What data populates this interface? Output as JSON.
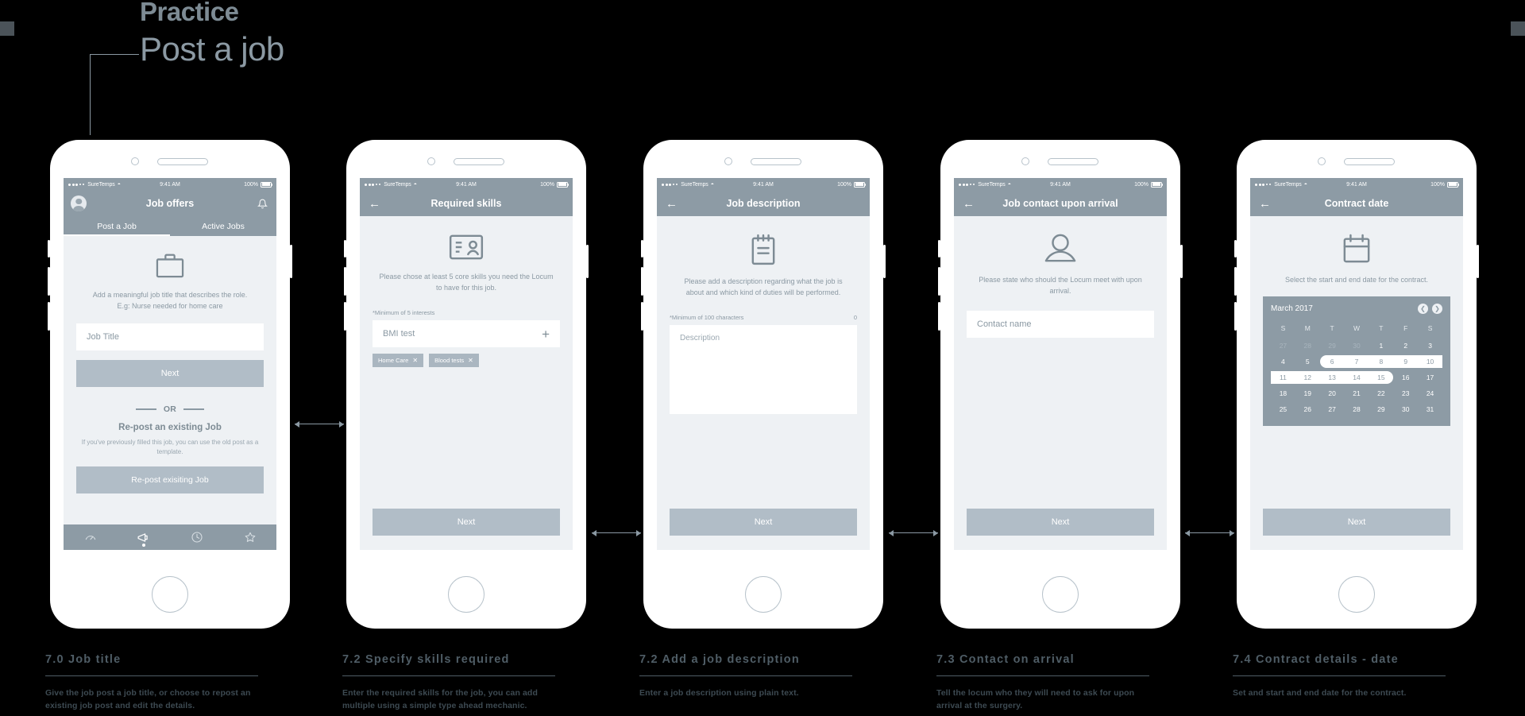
{
  "header": {
    "eyebrow": "Practice",
    "title": "Post a job"
  },
  "status_bar": {
    "carrier": "SureTemps",
    "time": "9:41 AM",
    "battery": "100%"
  },
  "screens": [
    {
      "id": "job-title",
      "nav_title": "Job offers",
      "left_icon": "avatar-icon",
      "right_icon": "bell-icon",
      "tabs": [
        {
          "label": "Post a Job",
          "active": true
        },
        {
          "label": "Active Jobs",
          "active": false
        }
      ],
      "hero_icon": "briefcase-icon",
      "helper": "Add a meaningful job title that describes the role.\nE.g: Nurse needed for home care",
      "field_placeholder": "Job Title",
      "next_label": "Next",
      "or_label": "OR",
      "repost_heading": "Re-post an existing Job",
      "repost_copy": "If you've previously filled this job, you can use the old post as a template.",
      "repost_button": "Re-post exisiting Job",
      "tabbar": [
        {
          "icon": "gauge-icon",
          "active": false
        },
        {
          "icon": "megaphone-icon",
          "active": true
        },
        {
          "icon": "clock-icon",
          "active": false
        },
        {
          "icon": "star-icon",
          "active": false
        }
      ]
    },
    {
      "id": "required-skills",
      "nav_title": "Required skills",
      "left_icon": "back-arrow-icon",
      "hero_icon": "id-card-icon",
      "helper": "Please chose at least 5 core skills you need the Locum to have for this job.",
      "minimum_label": "*Minimum of 5 interests",
      "field_value": "BMI test",
      "add_icon": "plus-icon",
      "chips": [
        "Home Care",
        "Blood tests"
      ],
      "next_label": "Next"
    },
    {
      "id": "job-description",
      "nav_title": "Job description",
      "left_icon": "back-arrow-icon",
      "hero_icon": "notepad-icon",
      "helper": "Please add a description regarding what the job is about and which kind of duties will be performed.",
      "minimum_label": "*Minimum of 100 characters",
      "counter": "0",
      "textarea_placeholder": "Description",
      "next_label": "Next"
    },
    {
      "id": "job-contact",
      "nav_title": "Job contact upon arrival",
      "left_icon": "back-arrow-icon",
      "hero_icon": "person-icon",
      "helper": "Please state who should the Locum meet with upon arrival.",
      "field_placeholder": "Contact name",
      "next_label": "Next"
    },
    {
      "id": "contract-date",
      "nav_title": "Contract date",
      "left_icon": "back-arrow-icon",
      "hero_icon": "calendar-icon",
      "helper": "Select the start and end date for the contract.",
      "next_label": "Next",
      "calendar": {
        "month": "March 2017",
        "prev_icon": "chevron-left-icon",
        "next_icon": "chevron-right-icon",
        "day_headers": [
          "S",
          "M",
          "T",
          "W",
          "T",
          "F",
          "S"
        ],
        "weeks": [
          [
            {
              "d": "27",
              "muted": true
            },
            {
              "d": "28",
              "muted": true
            },
            {
              "d": "29",
              "muted": true
            },
            {
              "d": "30",
              "muted": true
            },
            {
              "d": "1"
            },
            {
              "d": "2"
            },
            {
              "d": "3"
            }
          ],
          [
            {
              "d": "4"
            },
            {
              "d": "5"
            },
            {
              "d": "6",
              "sel": true
            },
            {
              "d": "7",
              "sel": true
            },
            {
              "d": "8",
              "sel": true
            },
            {
              "d": "9",
              "sel": true
            },
            {
              "d": "10",
              "sel": true
            }
          ],
          [
            {
              "d": "11",
              "sel": true
            },
            {
              "d": "12",
              "sel": true
            },
            {
              "d": "13",
              "sel": true
            },
            {
              "d": "14",
              "sel": true
            },
            {
              "d": "15",
              "sel": true
            },
            {
              "d": "16"
            },
            {
              "d": "17"
            }
          ],
          [
            {
              "d": "18"
            },
            {
              "d": "19"
            },
            {
              "d": "20"
            },
            {
              "d": "21"
            },
            {
              "d": "22"
            },
            {
              "d": "23"
            },
            {
              "d": "24"
            }
          ],
          [
            {
              "d": "25"
            },
            {
              "d": "26"
            },
            {
              "d": "27"
            },
            {
              "d": "28"
            },
            {
              "d": "29"
            },
            {
              "d": "30"
            },
            {
              "d": "31"
            }
          ]
        ],
        "range_start": "6",
        "range_end": "15"
      }
    }
  ],
  "captions": [
    {
      "title": "7.0 Job title",
      "body": "Give the job post a job title, or choose to repost an existing job post and edit the details."
    },
    {
      "title": "7.2 Specify skills required",
      "body": "Enter the required skills for the job, you can add multiple using a simple type ahead mechanic."
    },
    {
      "title": "7.2 Add a job description",
      "body": "Enter a job description using plain text."
    },
    {
      "title": "7.3 Contact on arrival",
      "body": "Tell the locum who they will need to ask for upon arrival at the surgery."
    },
    {
      "title": "7.4 Contract details - date",
      "body": "Set and start and end date for the contract."
    }
  ],
  "colors": {
    "background": "#000000",
    "chrome": "#8d9ba5",
    "screen_bg": "#eef1f4",
    "button": "#b1bdc7",
    "accent_text": "#4f5d66"
  }
}
